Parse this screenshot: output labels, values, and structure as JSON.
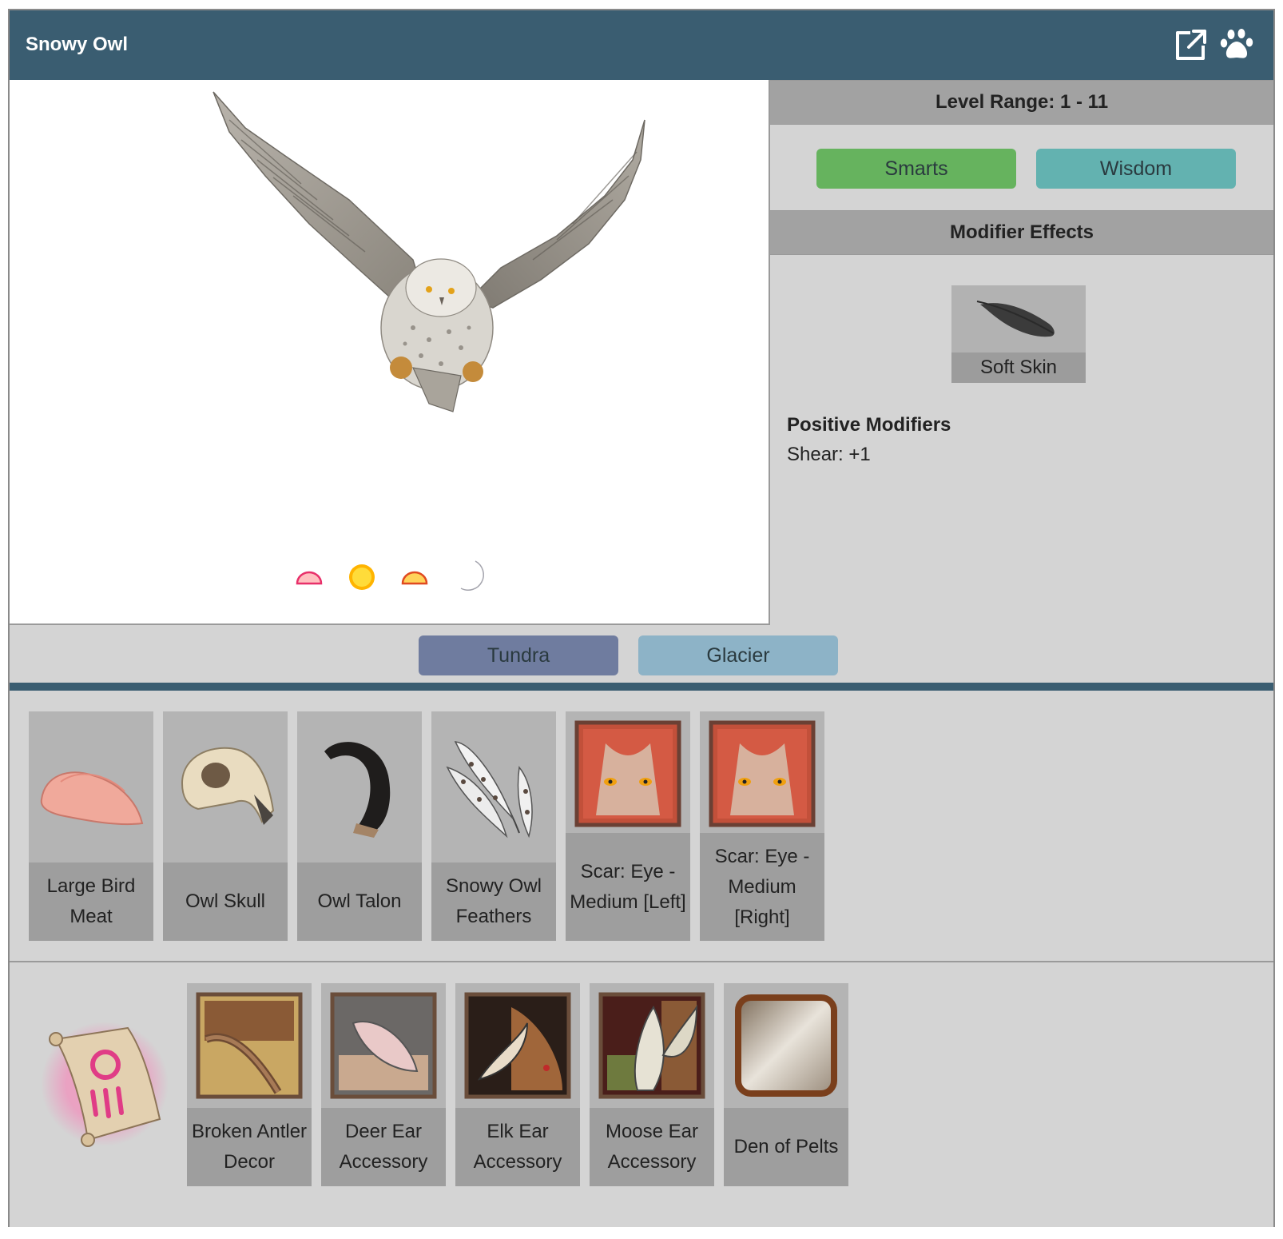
{
  "header": {
    "title": "Snowy Owl",
    "icons": [
      "external-link-icon",
      "paw-icon"
    ],
    "color": "#3a5d71"
  },
  "creature_image": {
    "icon": "snowy-owl-image"
  },
  "times": [
    "dawn-icon",
    "day-icon",
    "dusk-icon",
    "night-icon"
  ],
  "level_range": {
    "label": "Level Range: 1 - 11"
  },
  "stats": [
    {
      "label": "Smarts",
      "color": "#66b35e"
    },
    {
      "label": "Wisdom",
      "color": "#63b2b0"
    }
  ],
  "modifier_effects": {
    "title": "Modifier Effects",
    "effect": {
      "label": "Soft Skin",
      "icon": "feather-icon"
    },
    "positive_title": "Positive Modifiers",
    "positive_line": "Shear: +1"
  },
  "biomes": [
    {
      "label": "Tundra",
      "color": "#6f7c9f"
    },
    {
      "label": "Glacier",
      "color": "#8db3c7"
    }
  ],
  "drops": [
    {
      "label": "Large Bird Meat",
      "icon": "meat-icon"
    },
    {
      "label": "Owl Skull",
      "icon": "skull-icon"
    },
    {
      "label": "Owl Talon",
      "icon": "talon-icon"
    },
    {
      "label": "Snowy Owl Feathers",
      "icon": "feathers-icon"
    },
    {
      "label": "Scar: Eye - Medium [Left]",
      "icon": "scar-eye-icon"
    },
    {
      "label": "Scar: Eye - Medium [Right]",
      "icon": "scar-eye-icon"
    }
  ],
  "rewards": {
    "icon": "quest-scroll-icon",
    "items": [
      {
        "label": "Broken Antler Decor",
        "icon": "antler-decor-icon"
      },
      {
        "label": "Deer Ear Accessory",
        "icon": "deer-ear-icon"
      },
      {
        "label": "Elk Ear Accessory",
        "icon": "elk-ear-icon"
      },
      {
        "label": "Moose Ear Accessory",
        "icon": "moose-ear-icon"
      },
      {
        "label": "Den of Pelts",
        "icon": "den-pelts-icon"
      }
    ]
  }
}
